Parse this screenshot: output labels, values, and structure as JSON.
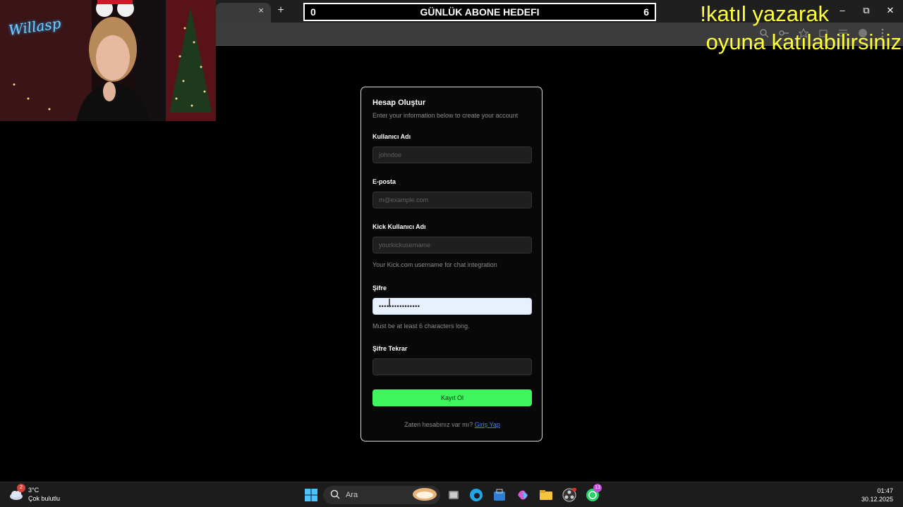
{
  "browser": {
    "tab_close": "×",
    "new_tab": "+",
    "window_controls": {
      "minimize": "–",
      "restore": "⧉",
      "close": "✕"
    }
  },
  "overlay": {
    "goal_left": "0",
    "goal_title": "GÜNLÜK ABONE HEDEFI",
    "goal_right": "6",
    "chat_line1": "!katıl yazarak",
    "chat_line2": "oyuna katılabilirsiniz"
  },
  "webcam": {
    "logo_text": "Willasp"
  },
  "form": {
    "title": "Hesap Oluştur",
    "subtitle": "Enter your information below to create your account",
    "username_label": "Kullanıcı Adı",
    "username_placeholder": "johndoe",
    "email_label": "E-posta",
    "email_placeholder": "m@example.com",
    "kick_label": "Kick Kullanıcı Adı",
    "kick_placeholder": "yourkickusername",
    "kick_hint": "Your Kick.com username for chat integration",
    "password_label": "Şifre",
    "password_value": "••••••••••••••••",
    "password_hint": "Must be at least 6 characters long.",
    "confirm_label": "Şifre Tekrar",
    "confirm_value": "",
    "submit_label": "Kayıt Ol",
    "footer_text": "Zaten hesabınız var mı?",
    "footer_link": "Giriş Yap"
  },
  "taskbar": {
    "weather_badge": "2",
    "weather_temp": "3°C",
    "weather_desc": "Çok bulutlu",
    "search_placeholder": "Ara",
    "whatsapp_badge": "13",
    "time": "01:47",
    "date": "30.12.2025"
  },
  "colors": {
    "accent_green": "#3ff55e",
    "link_blue": "#4a7dff",
    "overlay_yellow": "#ffff3a"
  }
}
